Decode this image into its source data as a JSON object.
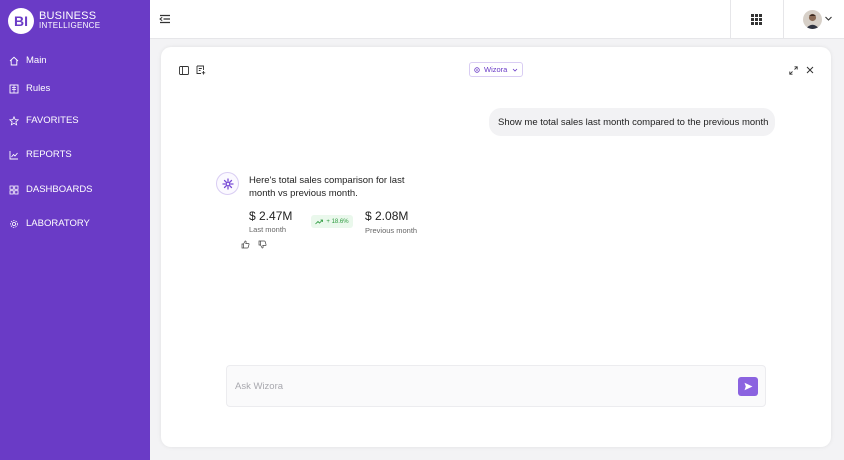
{
  "brand": {
    "logo": "BI",
    "line1": "BUSINESS",
    "line2": "INTELLIGENCE"
  },
  "sidebar": {
    "items": [
      {
        "label": "Main",
        "icon": "home-icon"
      },
      {
        "label": "Rules",
        "icon": "rules-icon"
      },
      {
        "label": "FAVORITES",
        "icon": "star-icon"
      },
      {
        "label": "REPORTS",
        "icon": "chart-line-icon"
      },
      {
        "label": "DASHBOARDS",
        "icon": "grid-icon"
      },
      {
        "label": "LABORATORY",
        "icon": "gear-icon"
      }
    ]
  },
  "topbar": {
    "icons": [
      "menu-collapse-icon",
      "apps-grid-icon",
      "avatar",
      "chevron-down-icon"
    ]
  },
  "chat": {
    "assistant_selector": "Wizora",
    "user_message": "Show me total sales last month compared to the previous month",
    "reply_text": "Here's total sales comparison for last month vs previous month.",
    "metrics": {
      "current_value": "$ 2.47M",
      "current_label": "Last month",
      "change": "+ 18.6%",
      "previous_value": "$ 2.08M",
      "previous_label": "Previous month"
    },
    "input_placeholder": "Ask Wizora"
  },
  "colors": {
    "brand": "#6a3bc6",
    "send": "#8b63e0",
    "positive": "#2c9a3e"
  }
}
